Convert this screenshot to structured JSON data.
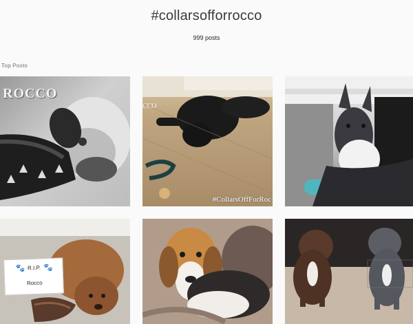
{
  "header": {
    "hashtag": "#collarsofforrocco",
    "posts_count": "999 posts"
  },
  "section": {
    "label": "Top Posts"
  },
  "posts": [
    {
      "overlay_text": "ROCCO"
    },
    {
      "overlay_text": "CCO",
      "watermark": "#CollarsOffForRoc"
    },
    {},
    {
      "card_title": "R.I.P.",
      "card_name": "Rocco"
    },
    {},
    {}
  ],
  "colors": {
    "background": "#fafafa",
    "text": "#262626",
    "muted": "#999999",
    "paw_blue": "#1b4aa0"
  },
  "icons": [
    "paw-icon"
  ]
}
